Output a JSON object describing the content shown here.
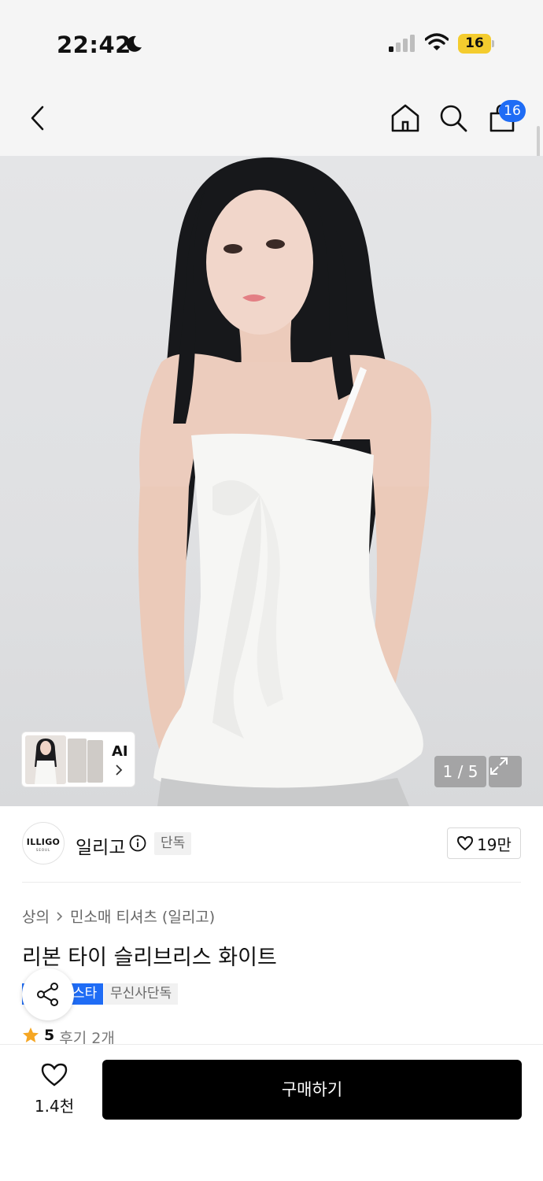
{
  "status_bar": {
    "time": "22:42",
    "battery": "16"
  },
  "nav": {
    "cart_count": "16"
  },
  "gallery": {
    "ai_label": "AI",
    "page_indicator": "1 / 5"
  },
  "brand": {
    "logo_text": "ILLIGO",
    "logo_subtext": "SEOUL",
    "name": "일리고",
    "exclusive_tag": "단독",
    "like_count": "19만"
  },
  "product": {
    "breadcrumb": [
      "상의",
      "민소매 티셔츠 (일리고)"
    ],
    "title": "리본 타이 슬리브리스 화이트",
    "tags": [
      "스타",
      "무신사단독"
    ],
    "rating": "5",
    "reviews": "후기 2개"
  },
  "bottom_bar": {
    "wish_count": "1.4천",
    "buy_label": "구매하기"
  },
  "colors": {
    "accent": "#1f6cf5",
    "battery": "#f4cc2e",
    "star": "#f5a623",
    "buy_button": "#000000"
  }
}
